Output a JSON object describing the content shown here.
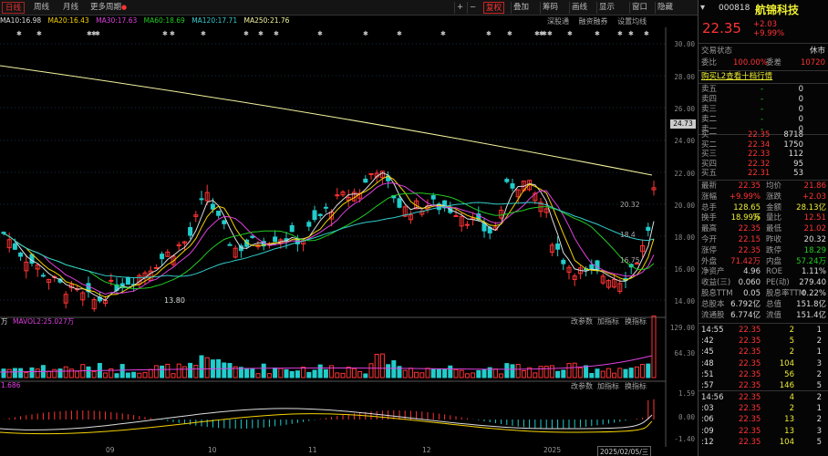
{
  "toolbar": {
    "tabs": [
      "日线",
      "周线",
      "月线",
      "更多周期"
    ],
    "buttons": [
      "+",
      "−",
      "复权",
      "叠加",
      "筹码",
      "画线",
      "显示",
      "窗口",
      "隐藏"
    ],
    "right_buttons": [
      "深股通",
      "融资融券",
      "设置均线"
    ],
    "ticker": "000818",
    "name": "航锦科技"
  },
  "ma_legend": [
    {
      "label": "MA10:16.98",
      "color": "#ddd"
    },
    {
      "label": "MA20:16.43",
      "color": "#f5d300"
    },
    {
      "label": "MA30:17.63",
      "color": "#e040e0"
    },
    {
      "label": "MA60:18.69",
      "color": "#2c2"
    },
    {
      "label": "MA120:17.71",
      "color": "#3cc"
    },
    {
      "label": "MA250:21.76",
      "color": "#f5f5a0"
    }
  ],
  "price_axis": [
    "30.00",
    "28.00",
    "26.00",
    "24.00",
    "22.00",
    "20.00",
    "18.00",
    "16.00",
    "14.00"
  ],
  "current_price_tag": "24.73",
  "chart_labels": {
    "low": "13.80",
    "ma_right1": "20.32",
    "ma_right2": "18.4",
    "ma_right3": "16.75"
  },
  "volume": {
    "legend": "万",
    "ma_legend": "MAVOL2:25.027万",
    "axis": [
      "129.00",
      "64.30"
    ],
    "buttons": [
      "改参数",
      "加指标",
      "换指标"
    ]
  },
  "macd": {
    "legend": "1.686",
    "axis": [
      "1.59",
      "0.00",
      "-1.40"
    ],
    "buttons": [
      "改参数",
      "加指标",
      "换指标"
    ]
  },
  "x_labels": [
    "09",
    "10",
    "11",
    "12",
    "2025",
    "2025/02/05/三"
  ],
  "chart_data": {
    "type": "candlestick",
    "x_ticks": [
      "09",
      "10",
      "11",
      "12",
      "2025"
    ],
    "y_range": [
      13,
      30
    ],
    "last_close": 22.35,
    "low_marker": 13.8
  },
  "quote": {
    "price": "22.35",
    "change": "+2.03",
    "pct": "+9.99%",
    "status_label": "交易状态",
    "status": "休市",
    "weibi_label": "委比",
    "weibi": "100.00%",
    "weicha_label": "委差",
    "weicha": "10720",
    "link": "购买L2查看十档行情"
  },
  "asks": [
    {
      "label": "卖五",
      "price": "",
      "vol": "0"
    },
    {
      "label": "卖四",
      "price": "",
      "vol": "0"
    },
    {
      "label": "卖三",
      "price": "",
      "vol": "0"
    },
    {
      "label": "卖二",
      "price": "",
      "vol": "0"
    },
    {
      "label": "卖一",
      "price": "",
      "vol": "0"
    }
  ],
  "bids": [
    {
      "label": "买一",
      "price": "22.35",
      "vol": "8718"
    },
    {
      "label": "买二",
      "price": "22.34",
      "vol": "1750"
    },
    {
      "label": "买三",
      "price": "22.33",
      "vol": "112"
    },
    {
      "label": "买四",
      "price": "22.32",
      "vol": "95"
    },
    {
      "label": "买五",
      "price": "22.31",
      "vol": "53"
    }
  ],
  "stats": [
    {
      "l1": "最新",
      "v1": "22.35",
      "c1": "red",
      "l2": "均价",
      "v2": "21.86",
      "c2": "red"
    },
    {
      "l1": "涨幅",
      "v1": "+9.99%",
      "c1": "red",
      "l2": "涨跌",
      "v2": "+2.03",
      "c2": "red"
    },
    {
      "l1": "总手",
      "v1": "128.65万",
      "c1": "yellow",
      "l2": "金额",
      "v2": "28.13亿",
      "c2": "yellow"
    },
    {
      "l1": "换手",
      "v1": "18.99%",
      "c1": "yellow",
      "l2": "量比",
      "v2": "12.51",
      "c2": "red"
    },
    {
      "l1": "最高",
      "v1": "22.35",
      "c1": "red",
      "l2": "最低",
      "v2": "21.02",
      "c2": "red"
    },
    {
      "l1": "今开",
      "v1": "22.15",
      "c1": "red",
      "l2": "昨收",
      "v2": "20.32",
      "c2": "white"
    },
    {
      "l1": "涨停",
      "v1": "22.35",
      "c1": "red",
      "l2": "跌停",
      "v2": "18.29",
      "c2": "green"
    },
    {
      "l1": "外盘",
      "v1": "71.42万",
      "c1": "red",
      "l2": "内盘",
      "v2": "57.24万",
      "c2": "green"
    },
    {
      "l1": "净资产",
      "v1": "4.96",
      "c1": "white",
      "l2": "ROE",
      "v2": "1.11%",
      "c2": "white"
    },
    {
      "l1": "收益(三)",
      "v1": "0.060",
      "c1": "white",
      "l2": "PE(动)",
      "v2": "279.40",
      "c2": "white"
    },
    {
      "l1": "股息TTM",
      "v1": "0.05",
      "c1": "white",
      "l2": "股息率TTM",
      "v2": "0.22%",
      "c2": "white"
    },
    {
      "l1": "总股本",
      "v1": "6.792亿",
      "c1": "white",
      "l2": "总值",
      "v2": "151.8亿",
      "c2": "white"
    },
    {
      "l1": "流通股",
      "v1": "6.774亿",
      "c1": "white",
      "l2": "流值",
      "v2": "151.4亿",
      "c2": "white"
    }
  ],
  "ticks1": [
    {
      "t": "14:55",
      "p": "22.35",
      "v": "2",
      "s": "1"
    },
    {
      "t": ":42",
      "p": "22.35",
      "v": "5",
      "s": "2"
    },
    {
      "t": ":45",
      "p": "22.35",
      "v": "2",
      "s": "1"
    },
    {
      "t": ":48",
      "p": "22.35",
      "v": "104",
      "s": "3"
    },
    {
      "t": ":51",
      "p": "22.35",
      "v": "56",
      "s": "2"
    },
    {
      "t": ":57",
      "p": "22.35",
      "v": "146",
      "s": "5"
    }
  ],
  "ticks2": [
    {
      "t": "14:56",
      "p": "22.35",
      "v": "4",
      "s": "2"
    },
    {
      "t": ":03",
      "p": "22.35",
      "v": "2",
      "s": "1"
    },
    {
      "t": ":06",
      "p": "22.35",
      "v": "13",
      "s": "2"
    },
    {
      "t": ":09",
      "p": "22.35",
      "v": "13",
      "s": "3"
    },
    {
      "t": ":12",
      "p": "22.35",
      "v": "104",
      "s": "5"
    }
  ]
}
